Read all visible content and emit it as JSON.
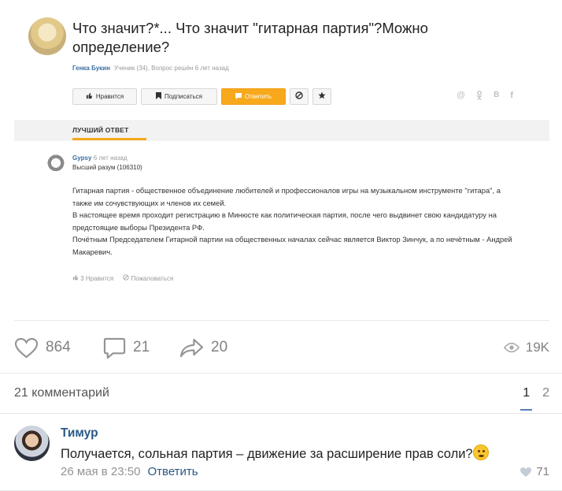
{
  "question": {
    "title": "Что значит?*... Что значит \"гитарная партия\"?Можно определение?",
    "author": "Генка Букин",
    "meta": "Ученик (34), Вопрос решён 6 лет назад",
    "toolbar": {
      "like_label": "Нравится",
      "subscribe_label": "Подписаться",
      "answer_label": "Ответить",
      "icons": [
        "thumb-up-icon",
        "bookmark-icon",
        "reply-icon",
        "block-icon",
        "star-icon"
      ]
    },
    "share_icons": [
      "mail-ru-icon",
      "odnoklassniki-icon",
      "vk-icon",
      "facebook-icon"
    ]
  },
  "best_answer": {
    "label": "ЛУЧШИЙ ОТВЕТ",
    "author": "Gypsy",
    "time": "6 лет назад",
    "rank": "Высший разум (106310)",
    "paragraphs": [
      "Гитарная партия - общественное объединение любителей и профессионалов игры на музыкальном инструменте \"гитара\", а также им сочувствующих и членов их семей.",
      "В настоящее время проходит регистрацию в Минюсте как политическая партия, после чего выдвинет свою кандидатуру на предстоящие выборы Президента РФ.",
      "Почётным Председателем Гитарной партии на общественных началах сейчас является Виктор Зинчук, а по нечётным - Андрей Макаревич."
    ],
    "likes_label": "3 Нравится",
    "report_label": "Пожаловаться"
  },
  "post": {
    "likes": "864",
    "comments": "21",
    "reposts": "20",
    "views": "19K"
  },
  "comments_section": {
    "count_label": "21 комментарий",
    "pages": [
      "1",
      "2"
    ],
    "active_page": "1"
  },
  "comment": {
    "author": "Тимур",
    "text": "Получается, сольная партия – движение за расширение прав соли?",
    "date": "26 мая в 23:50",
    "reply_label": "Ответить",
    "likes": "71"
  },
  "colors": {
    "vk_link": "#2a5885",
    "vk_blue": "#5181b8",
    "answer_orange": "#f7a81b",
    "muted": "#828282"
  }
}
